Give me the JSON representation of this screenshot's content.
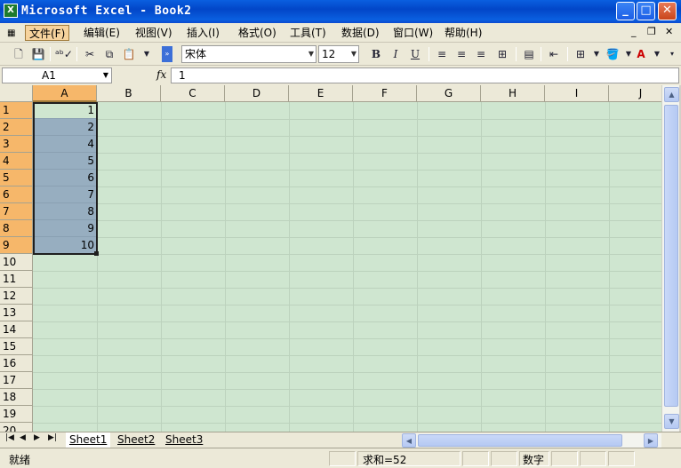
{
  "window": {
    "title": "Microsoft Excel - Book2",
    "app_icon": "excel-icon",
    "buttons": {
      "minimize": "_",
      "maximize": "□",
      "close": "✕"
    }
  },
  "menubar": {
    "items": [
      "文件(F)",
      "编辑(E)",
      "视图(V)",
      "插入(I)",
      "格式(O)",
      "工具(T)",
      "数据(D)",
      "窗口(W)",
      "帮助(H)"
    ],
    "doc_controls": {
      "minimize": "_",
      "restore": "❐",
      "close": "✕"
    }
  },
  "toolbar": {
    "font_name": "宋体",
    "font_size": "12",
    "bold": "B",
    "italic": "I",
    "underline": "U"
  },
  "formula_bar": {
    "name_box": "A1",
    "fx": "fx",
    "value": "1"
  },
  "sheet": {
    "columns": [
      "A",
      "B",
      "C",
      "D",
      "E",
      "F",
      "G",
      "H",
      "I",
      "J"
    ],
    "rows": [
      "1",
      "2",
      "3",
      "4",
      "5",
      "6",
      "7",
      "8",
      "9",
      "10",
      "11",
      "12",
      "13",
      "14",
      "15",
      "16",
      "17",
      "18",
      "19",
      "20"
    ],
    "column_a_values": [
      "1",
      "2",
      "4",
      "5",
      "6",
      "7",
      "8",
      "9",
      "10"
    ]
  },
  "sheet_tabs": {
    "nav": [
      "|◀",
      "◀",
      "▶",
      "▶|"
    ],
    "tabs": [
      "Sheet1",
      "Sheet2",
      "Sheet3"
    ]
  },
  "status_bar": {
    "mode": "就绪",
    "sum": "求和=52",
    "num_lock": "数字"
  },
  "colors": {
    "title_bar": "#0a5fe0",
    "grid_background": "#cfe6d0",
    "selection": "#97aec0",
    "header_selected": "#f6b76a"
  }
}
